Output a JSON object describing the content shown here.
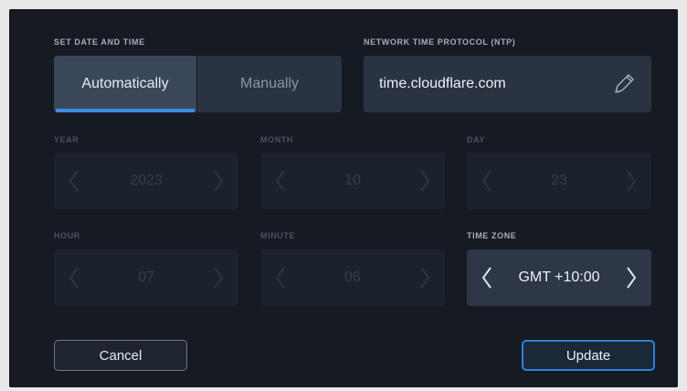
{
  "date_time": {
    "section_label": "SET DATE AND TIME",
    "mode_automatic_label": "Automatically",
    "mode_manual_label": "Manually",
    "selected_mode": "Automatically"
  },
  "ntp": {
    "section_label": "NETWORK TIME PROTOCOL (NTP)",
    "server": "time.cloudflare.com",
    "edit_icon": "pencil-icon"
  },
  "fields": {
    "year": {
      "label": "YEAR",
      "value": "2023",
      "enabled": false
    },
    "month": {
      "label": "MONTH",
      "value": "10",
      "enabled": false
    },
    "day": {
      "label": "DAY",
      "value": "23",
      "enabled": false
    },
    "hour": {
      "label": "HOUR",
      "value": "07",
      "enabled": false
    },
    "minute": {
      "label": "MINUTE",
      "value": "06",
      "enabled": false
    },
    "time_zone": {
      "label": "TIME ZONE",
      "value": "GMT +10:00",
      "enabled": true
    }
  },
  "actions": {
    "cancel_label": "Cancel",
    "update_label": "Update"
  },
  "colors": {
    "background": "#151a23",
    "accent": "#3d8de0",
    "selected_segment": "#3a4759",
    "field_background": "#2a3342"
  }
}
